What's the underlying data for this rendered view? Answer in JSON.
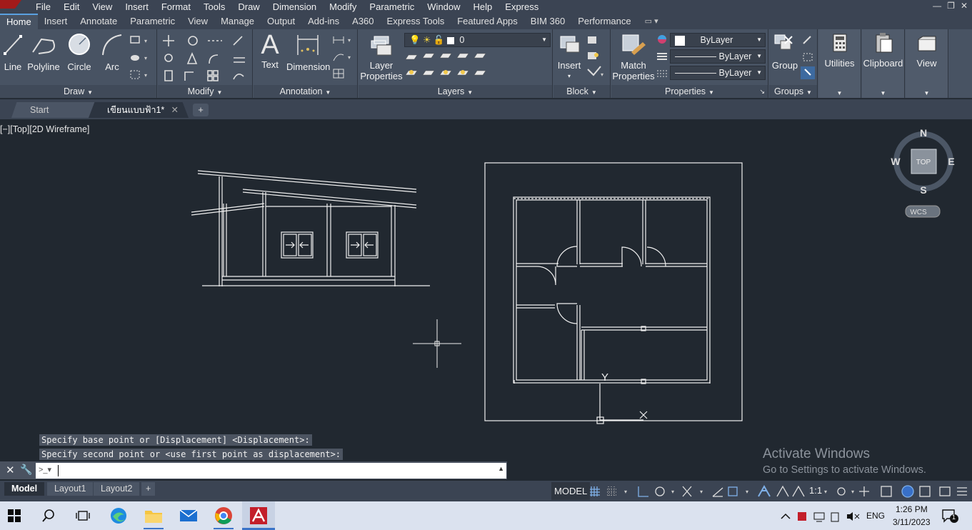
{
  "menu": [
    "File",
    "Edit",
    "View",
    "Insert",
    "Format",
    "Tools",
    "Draw",
    "Dimension",
    "Modify",
    "Parametric",
    "Window",
    "Help",
    "Express"
  ],
  "ribbon_tabs": [
    "Home",
    "Insert",
    "Annotate",
    "Parametric",
    "View",
    "Manage",
    "Output",
    "Add-ins",
    "A360",
    "Express Tools",
    "Featured Apps",
    "BIM 360",
    "Performance"
  ],
  "active_tab": "Home",
  "draw_panel": {
    "title": "Draw",
    "line": "Line",
    "polyline": "Polyline",
    "circle": "Circle",
    "arc": "Arc"
  },
  "modify_panel": {
    "title": "Modify"
  },
  "annotation_panel": {
    "title": "Annotation",
    "text": "Text",
    "dimension": "Dimension"
  },
  "layers_panel": {
    "title": "Layers",
    "layer_properties_1": "Layer",
    "layer_properties_2": "Properties",
    "current_layer": "0"
  },
  "block_panel": {
    "title": "Block",
    "insert": "Insert"
  },
  "properties_panel": {
    "title": "Properties",
    "match_1": "Match",
    "match_2": "Properties",
    "color": "ByLayer",
    "linetype": "ByLayer",
    "lineweight": "ByLayer"
  },
  "groups_panel": {
    "title": "Groups",
    "group": "Group"
  },
  "utilities": "Utilities",
  "clipboard": "Clipboard",
  "view_btn": "View",
  "file_tabs": {
    "start": "Start",
    "drawing": "เขียนแบบฟ้า1*"
  },
  "viewport": {
    "label": "[−][Top][2D Wireframe]"
  },
  "viewcube": {
    "n": "N",
    "s": "S",
    "e": "E",
    "w": "W",
    "top": "TOP",
    "wcs": "WCS"
  },
  "command_history": [
    "Specify base point or [Displacement] <Displacement>:",
    "Specify second point or <use first point as displacement>:"
  ],
  "ucs": {
    "y": "Y"
  },
  "watermark": {
    "line1": "Activate Windows",
    "line2": "Go to Settings to activate Windows."
  },
  "layout_tabs": [
    "Model",
    "Layout1",
    "Layout2"
  ],
  "status": {
    "model": "MODEL",
    "scale": "1:1"
  },
  "tray": {
    "lang": "ENG",
    "time": "1:26 PM",
    "date": "3/11/2023",
    "notifications": "1"
  }
}
